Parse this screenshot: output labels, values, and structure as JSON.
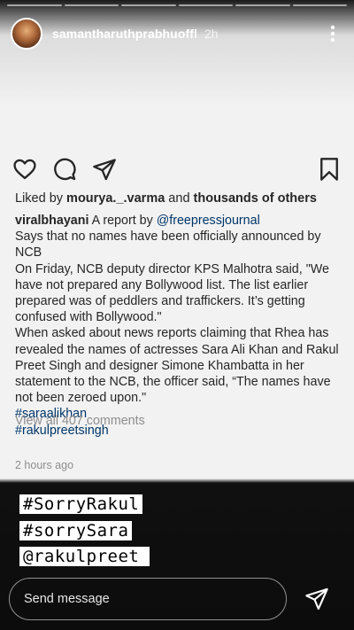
{
  "story": {
    "progress_segments": 6,
    "username": "samantharuthprabhuoffl",
    "time_ago": "2h"
  },
  "post": {
    "likes_prefix": "Liked by ",
    "likes_user": "mourya._.varma",
    "likes_mid": " and ",
    "likes_others": "thousands of others",
    "caption_user": "viralbhayani",
    "caption_text1": " A report by ",
    "caption_mention": "@freepressjournal",
    "line2": "Says that no names have been officially announced by NCB",
    "line3": "On Friday, NCB deputy director KPS Malhotra said, \"We have not prepared any Bollywood list. The list earlier prepared was of peddlers and traffickers. It’s getting confused with Bollywood.\"",
    "line4": "When asked about news reports claiming that Rhea has revealed the names of actresses Sara Ali Khan and Rakul Preet Singh and designer Simone Khambatta in her statement to the NCB, the officer said, “The names have not been zeroed upon.\"",
    "hashtag1": "#saraalikhan",
    "hashtag2": "#rakulpreetsingh",
    "comments_link": "View all 407 comments",
    "post_time": "2 hours ago"
  },
  "stickers": [
    "#SorryRakul",
    "#sorrySara",
    "@rakulpreet"
  ],
  "reply": {
    "placeholder": "Send message"
  },
  "icons": {
    "more": "more-vertical-icon",
    "like": "heart-icon",
    "comment": "comment-bubble-icon",
    "share": "paper-plane-icon",
    "save": "bookmark-icon",
    "send": "send-icon"
  }
}
